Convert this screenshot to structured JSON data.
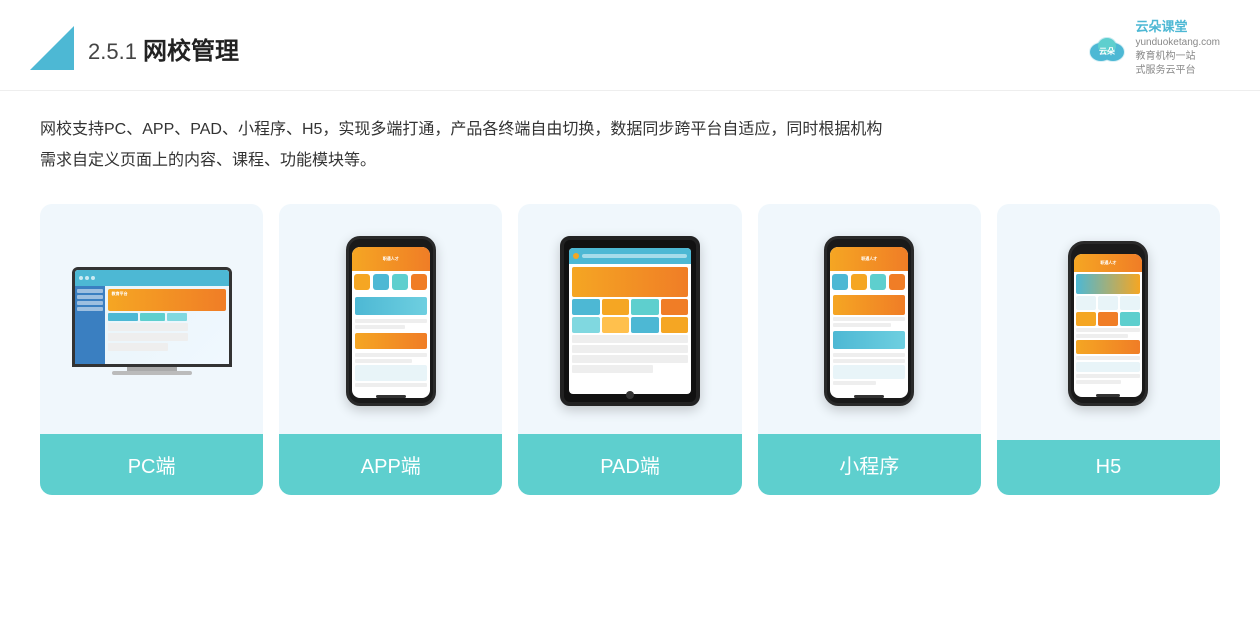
{
  "header": {
    "title_prefix": "2.5.1 ",
    "title": "网校管理",
    "brand": {
      "name": "云朵课堂",
      "url": "yunduoketang.com",
      "slogan1": "教育机构一站",
      "slogan2": "式服务云平台"
    }
  },
  "description": {
    "line1": "网校支持PC、APP、PAD、小程序、H5，实现多端打通，产品各终端自由切换，数据同步跨平台自适应，同时根据机构",
    "line2": "需求自定义页面上的内容、课程、功能模块等。"
  },
  "cards": [
    {
      "id": "pc",
      "label": "PC端"
    },
    {
      "id": "app",
      "label": "APP端"
    },
    {
      "id": "pad",
      "label": "PAD端"
    },
    {
      "id": "miniprogram",
      "label": "小程序"
    },
    {
      "id": "h5",
      "label": "H5"
    }
  ]
}
